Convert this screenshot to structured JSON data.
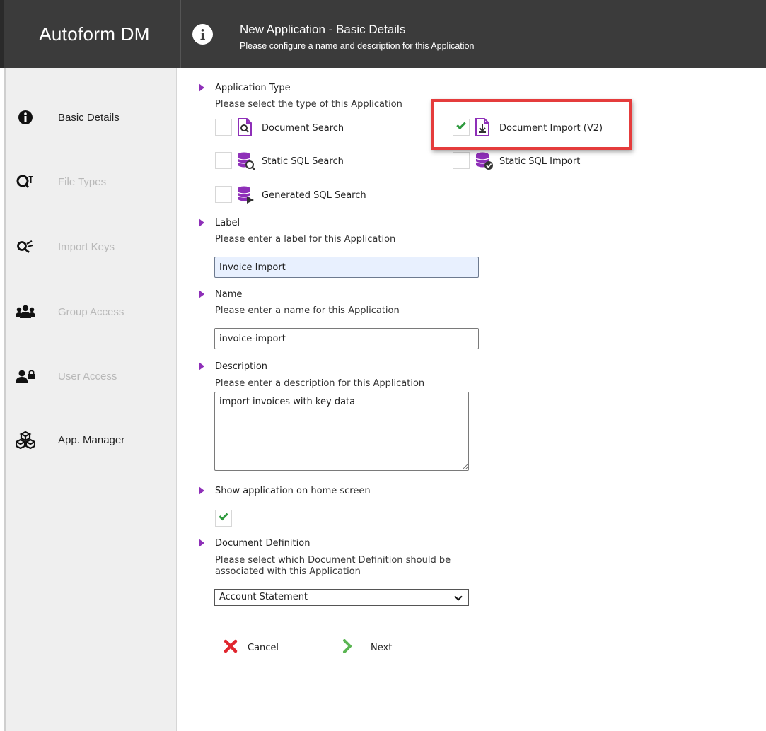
{
  "app": {
    "brand": "Autoform DM"
  },
  "header": {
    "title": "New Application - Basic Details",
    "subtitle": "Please configure a name and description for this Application",
    "icon": "info-icon"
  },
  "sidebar": {
    "items": [
      {
        "label": "Basic Details",
        "icon": "info-icon",
        "state": "active"
      },
      {
        "label": "File Types",
        "icon": "file-types-icon",
        "state": "disabled"
      },
      {
        "label": "Import Keys",
        "icon": "import-keys-icon",
        "state": "disabled"
      },
      {
        "label": "Group Access",
        "icon": "group-icon",
        "state": "disabled"
      },
      {
        "label": "User Access",
        "icon": "user-lock-icon",
        "state": "disabled"
      },
      {
        "label": "App. Manager",
        "icon": "cubes-icon",
        "state": "active"
      }
    ]
  },
  "form": {
    "application_type": {
      "title": "Application Type",
      "description": "Please select the type of this Application",
      "options": [
        {
          "label": "Document Search",
          "checked": false,
          "icon": "document-search-icon"
        },
        {
          "label": "Document Import (V2)",
          "checked": true,
          "icon": "document-import-icon"
        },
        {
          "label": "Static SQL Search",
          "checked": false,
          "icon": "database-search-icon"
        },
        {
          "label": "Static SQL Import",
          "checked": false,
          "icon": "database-import-icon"
        },
        {
          "label": "Generated SQL Search",
          "checked": false,
          "icon": "database-generate-icon"
        }
      ]
    },
    "label": {
      "title": "Label",
      "description": "Please enter a label for this Application",
      "value": "Invoice Import"
    },
    "name": {
      "title": "Name",
      "description": "Please enter a name for this Application",
      "value": "invoice-import"
    },
    "description": {
      "title": "Description",
      "description": "Please enter a description for this Application",
      "value": "import invoices with key data"
    },
    "show_on_home": {
      "title": "Show application on home screen",
      "checked": true
    },
    "document_definition": {
      "title": "Document Definition",
      "description_line1": "Please select which Document Definition should be",
      "description_line2": "associated with this Application",
      "selected": "Account Statement"
    }
  },
  "actions": {
    "cancel_label": "Cancel",
    "next_label": "Next"
  },
  "colors": {
    "header_bg": "#3b3b3b",
    "accent_purple": "#8e2fb8",
    "check_green": "#2e9a3e",
    "highlight_red": "#e53c3c",
    "cancel_red": "#e0262f",
    "next_green": "#5ab552"
  }
}
